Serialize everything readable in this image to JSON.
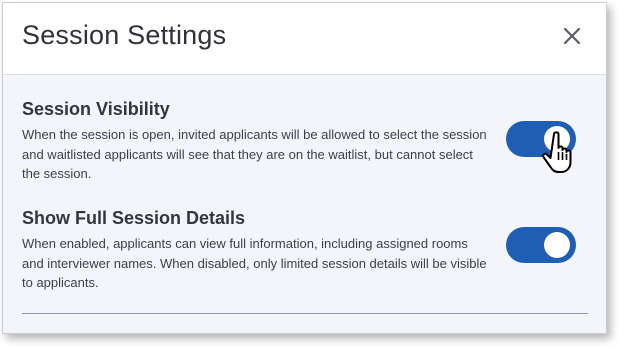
{
  "dialog": {
    "title": "Session Settings",
    "close_icon": "close-icon"
  },
  "settings": [
    {
      "title": "Session Visibility",
      "description": "When the session is open, invited applicants will be allowed to select the session and waitlisted applicants will see that they are on the waitlist, but cannot select the session.",
      "enabled": true
    },
    {
      "title": "Show Full Session Details",
      "description": "When enabled, applicants can view full information, including assigned rooms and interviewer names. When disabled, only limited session details will be visible to applicants.",
      "enabled": true
    }
  ],
  "colors": {
    "toggle_on": "#1e5fb4",
    "panel_bg": "#f3f5fa",
    "title_text": "#2f3237"
  },
  "cursor_icon": "hand-pointer-icon"
}
